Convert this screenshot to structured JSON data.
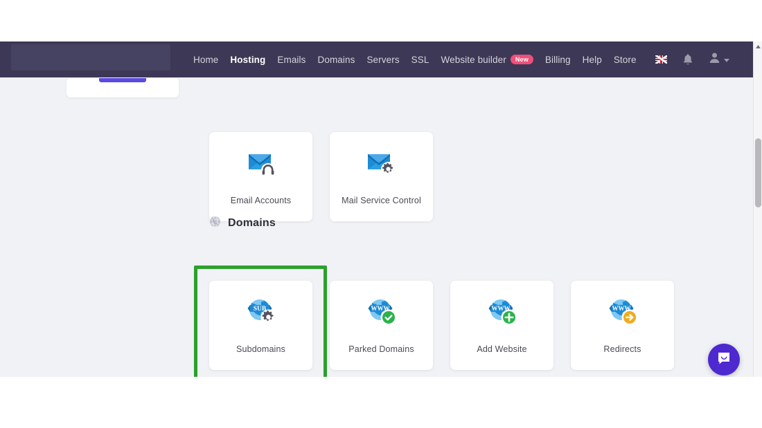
{
  "navbar": {
    "logo_placeholder": "",
    "links": [
      {
        "label": "Home",
        "active": false,
        "badge": null
      },
      {
        "label": "Hosting",
        "active": true,
        "badge": null
      },
      {
        "label": "Emails",
        "active": false,
        "badge": null
      },
      {
        "label": "Domains",
        "active": false,
        "badge": null
      },
      {
        "label": "Servers",
        "active": false,
        "badge": null
      },
      {
        "label": "SSL",
        "active": false,
        "badge": null
      },
      {
        "label": "Website builder",
        "active": false,
        "badge": "New"
      },
      {
        "label": "Billing",
        "active": false,
        "badge": null
      },
      {
        "label": "Help",
        "active": false,
        "badge": null
      },
      {
        "label": "Store",
        "active": false,
        "badge": null
      }
    ],
    "badge_text": "New",
    "right_icons": {
      "language_flag": "uk-flag-icon",
      "notifications": "bell-icon",
      "account": "user-avatar-icon",
      "account_caret": "chevron-down-icon"
    },
    "background_color": "#3c3855",
    "badge_color": "#ef4f7a"
  },
  "email_section": {
    "tiles": [
      {
        "label": "Email Accounts",
        "icon": "envelope-headset-icon"
      },
      {
        "label": "Mail Service Control",
        "icon": "envelope-gear-icon"
      }
    ]
  },
  "domains_section": {
    "heading": "Domains",
    "heading_icon": "globe-icon",
    "tiles": [
      {
        "label": "Subdomains",
        "icon": "globe-sub-gear-icon",
        "highlighted": true
      },
      {
        "label": "Parked Domains",
        "icon": "globe-www-check-icon",
        "highlighted": false
      },
      {
        "label": "Add Website",
        "icon": "globe-www-plus-icon",
        "highlighted": false
      },
      {
        "label": "Redirects",
        "icon": "globe-www-arrow-icon",
        "highlighted": false
      }
    ],
    "highlight_color": "#2ca02c"
  },
  "chat": {
    "launcher_icon": "chat-bubble-icon",
    "color": "#4d29cf"
  },
  "scrollbar": {
    "up_arrow_icon": "caret-up-icon",
    "thumb": "scroll-thumb"
  },
  "page": {
    "background_color": "#f0f2f5"
  }
}
